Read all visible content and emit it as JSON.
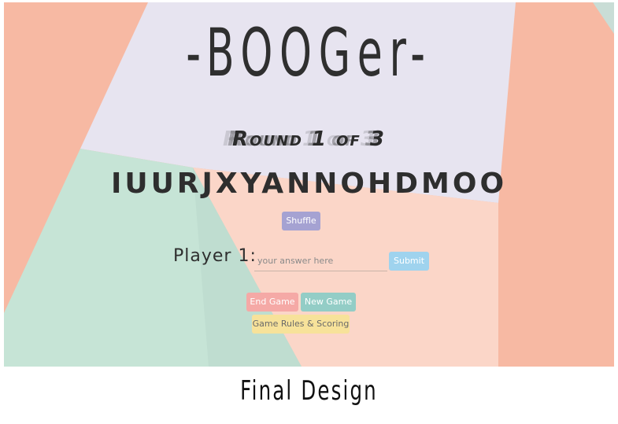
{
  "game": {
    "title": "-BOOGer-",
    "round": "Round 1 of 3",
    "letters": "IUURJXYANNOHDMOO"
  },
  "controls": {
    "shuffle_label": "Shuffle",
    "player_label": "Player 1:",
    "answer_placeholder": "your answer here",
    "submit_label": "Submit",
    "end_label": "End Game",
    "new_label": "New Game",
    "rules_label": "Game Rules & Scoring"
  },
  "caption": "Final Design",
  "colors": {
    "peach": "#f7b9a3",
    "lavender": "#e7e4f0",
    "mint": "#c6e4d6",
    "light_peach": "#fbd6c8",
    "shuffle": "#a5a2d2",
    "submit": "#9fd3ee",
    "end_game": "#f5a9a6",
    "new_game": "#93cdc6",
    "rules": "#f7e29a"
  }
}
